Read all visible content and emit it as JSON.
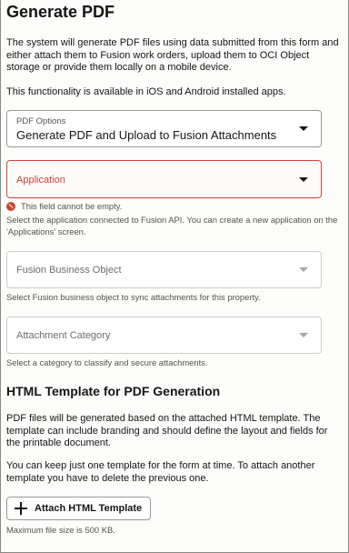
{
  "page": {
    "title": "Generate PDF",
    "intro": "The system will generate PDF files using data submitted from this form and either attach them to Fusion work orders, upload them to OCI Object storage or provide them locally on a mobile device.",
    "availability": "This functionality is available in iOS and Android installed apps."
  },
  "pdf_options": {
    "label": "PDF Options",
    "value": "Generate PDF and Upload to Fusion Attachments"
  },
  "application": {
    "placeholder": "Application",
    "error": "This field cannot be empty.",
    "helper": "Select the application connected to Fusion API. You can create a new application on the 'Applications' screen."
  },
  "fusion_business_object": {
    "placeholder": "Fusion Business Object",
    "helper": "Select Fusion business object to sync attachments for this property."
  },
  "attachment_category": {
    "placeholder": "Attachment Category",
    "helper": "Select a category to classify and secure attachments."
  },
  "template_section": {
    "title": "HTML Template for PDF Generation",
    "description": "PDF files will be generated based on the attached HTML template. The template can include branding and should define the layout and fields for the printable document.",
    "note": "You can keep just one template for the form at time. To attach another template you have to delete the previous one.",
    "attach_button": "Attach HTML Template",
    "size_limit": "Maximum file size is 500 KB."
  },
  "icons": {
    "error": "error-circle-icon",
    "dropdown": "chevron-down-icon",
    "add": "plus-icon"
  },
  "colors": {
    "error": "#c74634",
    "text": "#161513",
    "muted": "#56524d"
  }
}
